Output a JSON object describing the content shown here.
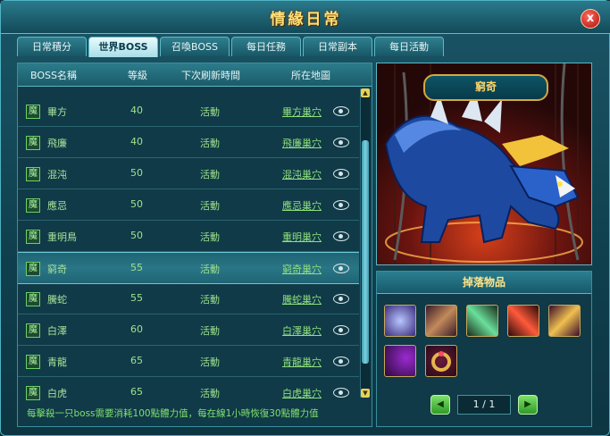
{
  "window": {
    "title": "情緣日常",
    "close_label": "x"
  },
  "tabs": [
    {
      "label": "日常積分"
    },
    {
      "label": "世界BOSS"
    },
    {
      "label": "召喚BOSS"
    },
    {
      "label": "每日任務"
    },
    {
      "label": "日常副本"
    },
    {
      "label": "每日活動"
    }
  ],
  "active_tab": "世界BOSS",
  "table": {
    "headers": [
      "BOSS名稱",
      "等級",
      "下次刷新時間",
      "所在地圖"
    ],
    "rows": [
      {
        "tag": "魔",
        "name": "畢方",
        "level": "40",
        "time": "活動",
        "map": "畢方巢穴"
      },
      {
        "tag": "魔",
        "name": "飛廉",
        "level": "40",
        "time": "活動",
        "map": "飛廉巢穴"
      },
      {
        "tag": "魔",
        "name": "混沌",
        "level": "50",
        "time": "活動",
        "map": "混沌巢穴"
      },
      {
        "tag": "魔",
        "name": "應忌",
        "level": "50",
        "time": "活動",
        "map": "應忌巢穴"
      },
      {
        "tag": "魔",
        "name": "重明鳥",
        "level": "50",
        "time": "活動",
        "map": "重明巢穴"
      },
      {
        "tag": "魔",
        "name": "窮奇",
        "level": "55",
        "time": "活動",
        "map": "窮奇巢穴"
      },
      {
        "tag": "魔",
        "name": "騰蛇",
        "level": "55",
        "time": "活動",
        "map": "騰蛇巢穴"
      },
      {
        "tag": "魔",
        "name": "白澤",
        "level": "60",
        "time": "活動",
        "map": "白澤巢穴"
      },
      {
        "tag": "魔",
        "name": "青龍",
        "level": "65",
        "time": "活動",
        "map": "青龍巢穴"
      },
      {
        "tag": "魔",
        "name": "白虎",
        "level": "65",
        "time": "活動",
        "map": "白虎巢穴"
      }
    ],
    "selected": "窮奇"
  },
  "footer_note": "每擊殺一只boss需要消耗100點體力值，每在線1小時恢復30點體力值",
  "portrait": {
    "boss_name": "窮奇"
  },
  "drops": {
    "title": "掉落物品",
    "items": [
      "crystal-orb-icon",
      "horn-staff-icon",
      "green-blade-icon",
      "red-sword-icon",
      "scroll-icon",
      "bow-icon",
      "ring-icon"
    ]
  },
  "pager": {
    "text": "1 / 1",
    "prev": "◀",
    "next": "▶"
  }
}
